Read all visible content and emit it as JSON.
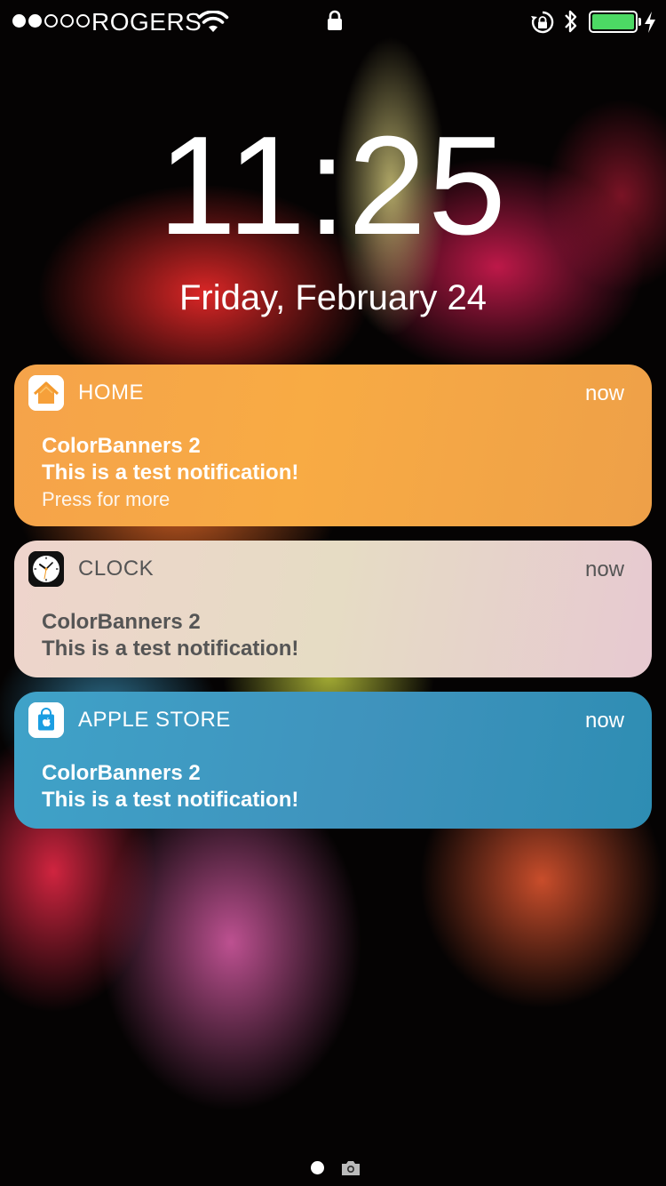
{
  "status_bar": {
    "signal_dots_filled": 2,
    "signal_dots_total": 5,
    "carrier": "ROGERS",
    "wifi_icon": "wifi-icon",
    "lock_icon": "lock-icon",
    "rotation_lock_icon": "rotation-lock-icon",
    "bluetooth_icon": "bluetooth-icon",
    "battery_level": 1.0,
    "battery_color": "#4cd964",
    "charging_icon": "charging-bolt-icon"
  },
  "lock_screen": {
    "time": "11:25",
    "date": "Friday, February 24"
  },
  "notifications": [
    {
      "app": "HOME",
      "icon": "home-app-icon",
      "time": "now",
      "title": "ColorBanners 2",
      "body": "This is a test notification!",
      "more": "Press for more",
      "color": "#f5a34a"
    },
    {
      "app": "CLOCK",
      "icon": "clock-app-icon",
      "time": "now",
      "title": "ColorBanners 2",
      "body": "This is a test notification!",
      "color": "#ead8cc"
    },
    {
      "app": "APPLE STORE",
      "icon": "apple-store-app-icon",
      "time": "now",
      "title": "ColorBanners 2",
      "body": "This is a test notification!",
      "color": "#3f99c2"
    }
  ],
  "bottom": {
    "page_dot": "page-dot",
    "camera_icon": "camera-icon"
  }
}
